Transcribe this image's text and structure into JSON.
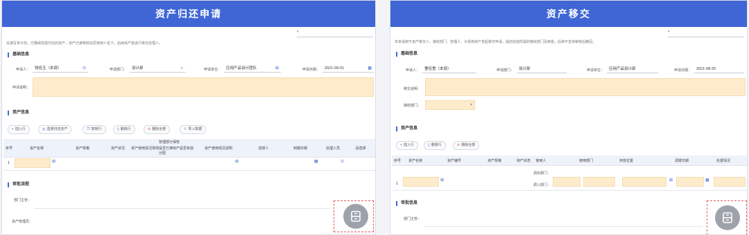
{
  "left": {
    "title": "资产归还申请",
    "note": "在填写单子前，已确保您需归还的资产，资产已被移除在原使用人名下，后续资产需进行移交处理人。",
    "top_select": "",
    "sections": {
      "basic": "基础信息",
      "asset": "资产信息",
      "approval": "审批流程"
    },
    "fields": {
      "applicant_label": "申请人：",
      "applicant_value": "钱佳玉（本部）",
      "dept_label": "申请部门：",
      "dept_value": "设计部",
      "unit_label": "申请单位：",
      "unit_value": "应用产品设计团队",
      "date_label": "申请日期：",
      "date_value": "2021-09-01",
      "reason_label": "申请说明："
    },
    "buttons": [
      "插入行",
      "选择归还资产",
      "复制行",
      "删除行",
      "删除全部",
      "导入数据"
    ],
    "columns": [
      "序号",
      "资产名称",
      "资产规格",
      "资产状况",
      "资产使用情况",
      "场地是否已满分配",
      "资产是否有损",
      "资产使用情况说明",
      "选择人",
      "到期日期",
      "处理人员",
      "请选择"
    ],
    "header_sub": "管理部分保管",
    "row_index": "1",
    "approval": {
      "dept_label": "部门主管：",
      "mgr_label": "资产管理员："
    }
  },
  "right": {
    "title": "资产移交",
    "note": "本单适用于资产移交人、接收部门、管理人、为领用资产发起移交申请，提前完成所需的接收部门及审批，后续不支持审核后撤回。",
    "top_select": "",
    "sections": {
      "basic": "基础信息",
      "asset": "资产信息",
      "approval": "审批信息"
    },
    "fields": {
      "applicant_label": "申请人：",
      "applicant_value": "曹佳雪（本部）",
      "dept_label": "申请部门：",
      "dept_value": "设计部",
      "unit_label": "申请单位：",
      "unit_value": "应用产品设计部",
      "date_label": "申请日期：",
      "date_value": "2021-08-25",
      "reason_label": "移交说明：",
      "receiver_label": "接收部门："
    },
    "buttons": [
      "插入行",
      "删除行",
      "删除全部"
    ],
    "columns": [
      "序号",
      "资产名称",
      "资产编号",
      "资产规格",
      "资产状态",
      "使用人",
      "使用部门",
      "存放位置",
      "调拨日期",
      "处置情况"
    ],
    "sub_labels": [
      "调出部门：",
      "调入部门："
    ],
    "row_index": "1",
    "approval": {
      "dept_label": "部门主管："
    }
  },
  "colors": {
    "header": "#3f66d4",
    "highlight": "#fdebcc",
    "dashed": "#e0595a"
  },
  "icons": [
    "person-icon",
    "calendar-icon",
    "plus-icon",
    "copy-icon",
    "delete-icon",
    "import-icon",
    "select-icon",
    "print-icon"
  ]
}
